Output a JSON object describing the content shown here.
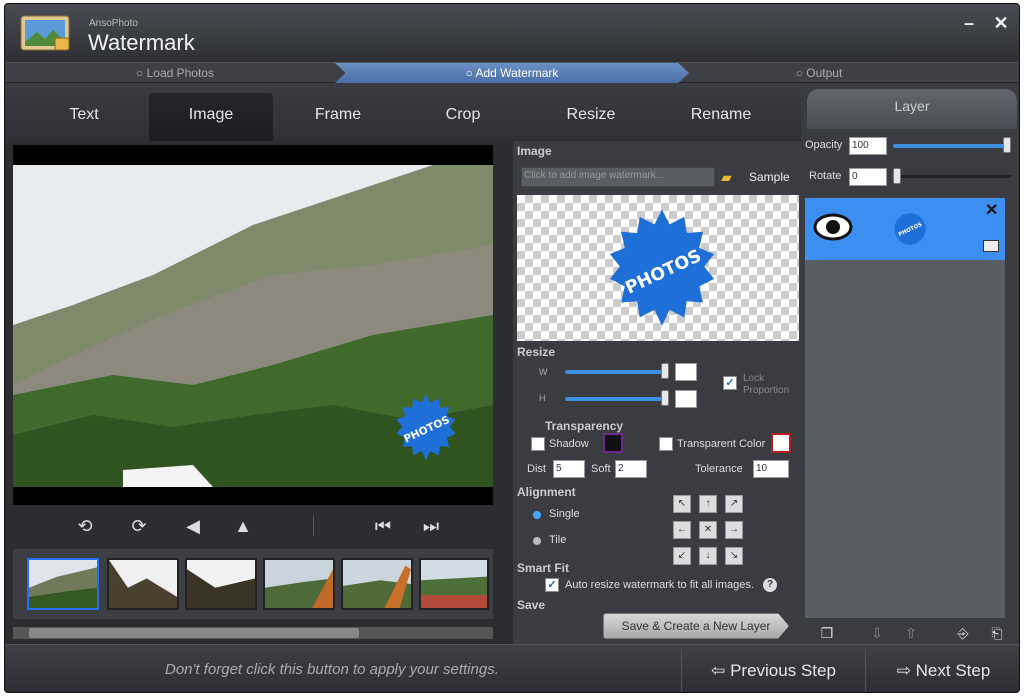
{
  "app": {
    "brand_small": "AnsoPhoto",
    "brand_big": "Watermark",
    "minimize": "–",
    "close": "✕"
  },
  "steps": [
    {
      "label": "Load Photos"
    },
    {
      "label": "Add Watermark"
    },
    {
      "label": "Output"
    }
  ],
  "tabs": [
    {
      "label": "Text"
    },
    {
      "label": "Image"
    },
    {
      "label": "Frame"
    },
    {
      "label": "Crop"
    },
    {
      "label": "Resize"
    },
    {
      "label": "Rename"
    }
  ],
  "preview": {
    "watermark_text": "PHOTOS"
  },
  "image_section": {
    "title": "Image",
    "placeholder": "Click to add image watermark...",
    "sample_label": "Sample",
    "sample_text": "PHOTOS"
  },
  "resize_section": {
    "title": "Resize",
    "w_label": "W",
    "h_label": "H",
    "w_value": "",
    "h_value": "",
    "lock_label_line1": "Lock",
    "lock_label_line2": "Proportion"
  },
  "transparency_section": {
    "title": "Transparency",
    "shadow_label": "Shadow",
    "transparent_color_label": "Transparent Color",
    "dist_label": "Dist",
    "dist_value": "5",
    "soft_label": "Soft",
    "soft_value": "2",
    "tolerance_label": "Tolerance",
    "tolerance_value": "10"
  },
  "alignment_section": {
    "title": "Alignment",
    "single_label": "Single",
    "tile_label": "Tile"
  },
  "smartfit_section": {
    "title": "Smart Fit",
    "auto_label": "Auto resize watermark to fit all images."
  },
  "save_section": {
    "title": "Save",
    "button": "Save & Create a New Layer"
  },
  "layer": {
    "tab": "Layer",
    "opacity_label": "Opacity",
    "opacity_value": "100",
    "opacity_fraction": 1.0,
    "rotate_label": "Rotate",
    "rotate_value": "0",
    "item_text": "PHOTOS"
  },
  "bottom": {
    "hint": "Don't forget click this button to apply your settings.",
    "prev": "Previous Step",
    "next": "Next Step"
  },
  "colors": {
    "accent": "#3c8ff0",
    "step_active": "#5a7fb6",
    "badge_blue": "#1f6fd8"
  }
}
